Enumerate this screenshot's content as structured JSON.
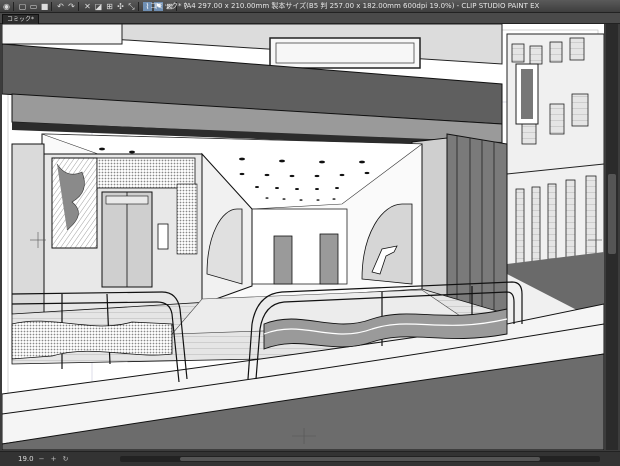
{
  "app": {
    "title": "コミック* (A4 297.00 x 210.00mm 製本サイズ(B5 判 257.00 x 182.00mm 600dpi 19.0%)  - CLIP STUDIO PAINT EX"
  },
  "tabs": [
    {
      "label": "コミック*"
    }
  ],
  "status": {
    "zoom": "19.0"
  },
  "toolbar": {
    "buttons": [
      {
        "icon": "view-icon",
        "glyph": "◉"
      },
      {
        "icon": "new-file-icon",
        "glyph": "▢"
      },
      {
        "icon": "open-file-icon",
        "glyph": "▭"
      },
      {
        "icon": "save-icon",
        "glyph": "■"
      },
      {
        "icon": "undo-icon",
        "glyph": "↶"
      },
      {
        "icon": "redo-icon",
        "glyph": "↷"
      },
      {
        "icon": "clear-icon",
        "glyph": "✕"
      },
      {
        "icon": "fill-icon",
        "glyph": "◪"
      },
      {
        "icon": "select-all-icon",
        "glyph": "⊞"
      },
      {
        "icon": "transform-icon",
        "glyph": "✣"
      },
      {
        "icon": "scale-icon",
        "glyph": "⤡"
      },
      {
        "icon": "snap-ruler-icon",
        "glyph": "⌇"
      },
      {
        "icon": "snap-special-ruler-icon",
        "glyph": "⚑"
      },
      {
        "icon": "snap-grid-icon",
        "glyph": "⊠"
      },
      {
        "icon": "help-icon",
        "glyph": "?"
      }
    ]
  },
  "colors": {
    "chrome": "#3c3c3c",
    "accent": "#6f8fb3",
    "canvas": "#ffffff",
    "screentone": "#bdbdbd"
  }
}
